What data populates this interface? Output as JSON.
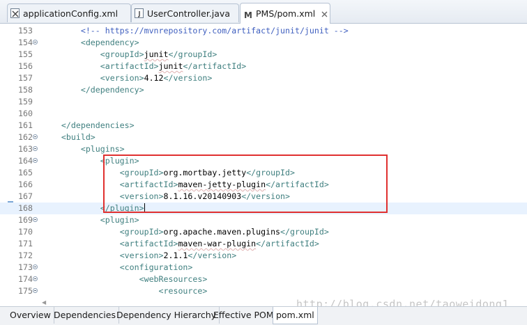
{
  "editor_tabs": [
    {
      "label": "applicationConfig.xml",
      "icon": "xml-file-icon"
    },
    {
      "label": "UserController.java",
      "icon": "java-file-icon"
    },
    {
      "label": "PMS/pom.xml",
      "icon": "maven-pom-icon"
    }
  ],
  "lines": [
    {
      "num": "153",
      "indent": "        ",
      "parts": [
        {
          "t": "<!-- https://mvnrepository.com/artifact/junit/junit -->",
          "c": "cmt"
        }
      ]
    },
    {
      "num": "154",
      "fold": true,
      "indent": "        ",
      "parts": [
        {
          "t": "<dependency>",
          "c": "tag"
        }
      ]
    },
    {
      "num": "155",
      "indent": "            ",
      "parts": [
        {
          "t": "<groupId>",
          "c": "tag"
        },
        {
          "t": "junit",
          "c": "txt",
          "squig": true
        },
        {
          "t": "</groupId>",
          "c": "tag"
        }
      ]
    },
    {
      "num": "156",
      "indent": "            ",
      "parts": [
        {
          "t": "<artifactId>",
          "c": "tag"
        },
        {
          "t": "junit",
          "c": "txt",
          "squig": true
        },
        {
          "t": "</artifactId>",
          "c": "tag"
        }
      ]
    },
    {
      "num": "157",
      "indent": "            ",
      "parts": [
        {
          "t": "<version>",
          "c": "tag"
        },
        {
          "t": "4.12",
          "c": "txt"
        },
        {
          "t": "</version>",
          "c": "tag"
        }
      ]
    },
    {
      "num": "158",
      "indent": "        ",
      "parts": [
        {
          "t": "</dependency>",
          "c": "tag"
        }
      ]
    },
    {
      "num": "159",
      "indent": "",
      "parts": []
    },
    {
      "num": "160",
      "indent": "",
      "parts": []
    },
    {
      "num": "161",
      "indent": "    ",
      "parts": [
        {
          "t": "</dependencies>",
          "c": "tag"
        }
      ]
    },
    {
      "num": "162",
      "fold": true,
      "indent": "    ",
      "parts": [
        {
          "t": "<build>",
          "c": "tag"
        }
      ]
    },
    {
      "num": "163",
      "fold": true,
      "indent": "        ",
      "parts": [
        {
          "t": "<plugins>",
          "c": "tag"
        }
      ]
    },
    {
      "num": "164",
      "fold": true,
      "indent": "            ",
      "parts": [
        {
          "t": "<plugin>",
          "c": "tag"
        }
      ]
    },
    {
      "num": "165",
      "indent": "                ",
      "parts": [
        {
          "t": "<groupId>",
          "c": "tag"
        },
        {
          "t": "org.mortbay.jetty",
          "c": "txt"
        },
        {
          "t": "</groupId>",
          "c": "tag"
        }
      ]
    },
    {
      "num": "166",
      "indent": "                ",
      "parts": [
        {
          "t": "<artifactId>",
          "c": "tag"
        },
        {
          "t": "maven-jetty-plugin",
          "c": "txt",
          "squig": true
        },
        {
          "t": "</artifactId>",
          "c": "tag"
        }
      ]
    },
    {
      "num": "167",
      "indent": "                ",
      "parts": [
        {
          "t": "<version>",
          "c": "tag"
        },
        {
          "t": "8.1.16.v20140903",
          "c": "txt"
        },
        {
          "t": "</version>",
          "c": "tag"
        }
      ]
    },
    {
      "num": "168",
      "current": true,
      "indent": "            ",
      "parts": [
        {
          "t": "</plugin>",
          "c": "tag"
        }
      ]
    },
    {
      "num": "169",
      "fold": true,
      "indent": "            ",
      "parts": [
        {
          "t": "<plugin>",
          "c": "tag"
        }
      ]
    },
    {
      "num": "170",
      "indent": "                ",
      "parts": [
        {
          "t": "<groupId>",
          "c": "tag"
        },
        {
          "t": "org.apache.maven.plugins",
          "c": "txt"
        },
        {
          "t": "</groupId>",
          "c": "tag"
        }
      ]
    },
    {
      "num": "171",
      "indent": "                ",
      "parts": [
        {
          "t": "<artifactId>",
          "c": "tag"
        },
        {
          "t": "maven-war-plugin",
          "c": "txt",
          "squig": true
        },
        {
          "t": "</artifactId>",
          "c": "tag"
        }
      ]
    },
    {
      "num": "172",
      "indent": "                ",
      "parts": [
        {
          "t": "<version>",
          "c": "tag"
        },
        {
          "t": "2.1.1",
          "c": "txt"
        },
        {
          "t": "</version>",
          "c": "tag"
        }
      ]
    },
    {
      "num": "173",
      "fold": true,
      "indent": "                ",
      "parts": [
        {
          "t": "<configuration>",
          "c": "tag"
        }
      ]
    },
    {
      "num": "174",
      "fold": true,
      "indent": "                    ",
      "parts": [
        {
          "t": "<webResources>",
          "c": "tag"
        }
      ]
    },
    {
      "num": "175",
      "fold": true,
      "indent": "                        ",
      "parts": [
        {
          "t": "<resource>",
          "c": "tag"
        }
      ]
    }
  ],
  "bottom_tabs": [
    "Overview",
    "Dependencies",
    "Dependency Hierarchy",
    "Effective POM",
    "pom.xml"
  ],
  "bottom_active": "pom.xml",
  "watermark": "http://blog.csdn.net/taoweidong1",
  "colors": {
    "tag": "#3f7f7f",
    "comment": "#3f5fbf",
    "highlight_box": "#e0302f",
    "current_line": "#e8f2fe"
  }
}
